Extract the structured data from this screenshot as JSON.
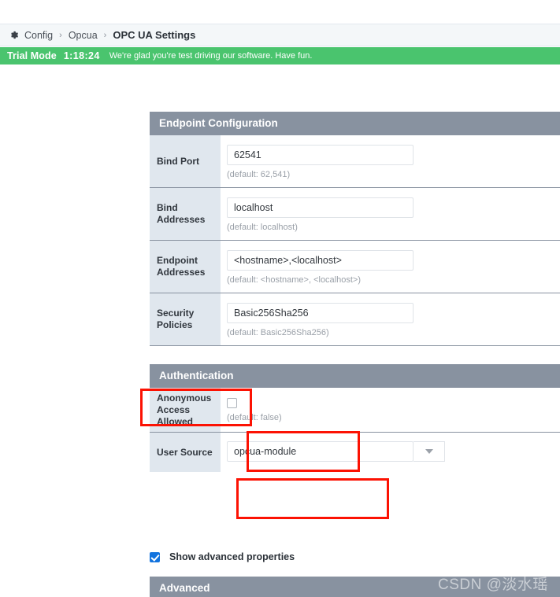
{
  "breadcrumb": {
    "gear_icon": "gear-icon",
    "items": [
      {
        "label": "Config",
        "active": false
      },
      {
        "label": "Opcua",
        "active": false
      },
      {
        "label": "OPC UA Settings",
        "active": true
      }
    ],
    "separator": "›"
  },
  "trial_banner": {
    "label": "Trial Mode",
    "timer": "1:18:24",
    "message": "We're glad you're test driving our software. Have fun.",
    "background_color": "#4ac46e"
  },
  "sections": {
    "endpoint": {
      "title": "Endpoint Configuration",
      "rows": [
        {
          "label": "Bind Port",
          "value": "62541",
          "default_hint": "(default: 62,541)",
          "type": "text"
        },
        {
          "label": "Bind Addresses",
          "value": "localhost",
          "default_hint": "(default: localhost)",
          "type": "text"
        },
        {
          "label": "Endpoint Addresses",
          "value": "<hostname>,<localhost>",
          "default_hint": "(default: <hostname>, <localhost>)",
          "type": "text"
        },
        {
          "label": "Security Policies",
          "value": "Basic256Sha256",
          "default_hint": "(default: Basic256Sha256)",
          "type": "text"
        }
      ]
    },
    "authentication": {
      "title": "Authentication",
      "rows": [
        {
          "label": "Anonymous Access Allowed",
          "value": "",
          "checked": false,
          "default_hint": "(default: false)",
          "type": "checkbox"
        },
        {
          "label": "User Source",
          "value": "opcua-module",
          "default_hint": "",
          "type": "select"
        }
      ]
    },
    "advanced": {
      "title": "Advanced"
    }
  },
  "advanced_toggle": {
    "label": "Show advanced properties",
    "checked": true,
    "accent_color": "#1273de"
  },
  "annotations": {
    "color": "#fc1203",
    "boxes": [
      {
        "name": "authentication-header"
      },
      {
        "name": "anonymous-access-field"
      },
      {
        "name": "user-source-field"
      }
    ]
  },
  "watermark": {
    "text": "CSDN @淡水瑶"
  },
  "theme": {
    "section_header_bg": "#8892a0",
    "label_cell_bg": "#e0e7ee",
    "page_bg": "#ffffff"
  }
}
